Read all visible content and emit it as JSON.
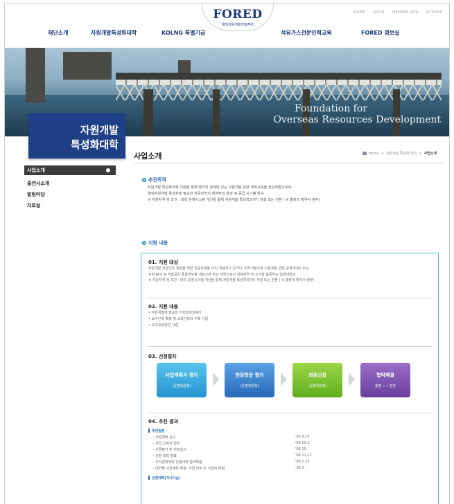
{
  "utility_links": [
    "HOME",
    "LOGIN",
    "MEMBER JOIN",
    "SITEMAP"
  ],
  "logo": {
    "main": "FORED",
    "sub": "해외자원개발진흥재단"
  },
  "nav": [
    "재단소개",
    "자원개발특성화대학",
    "KOLNG 특별기금",
    "석유가스전문인력교육",
    "FORED 정보실"
  ],
  "hero": {
    "line1": "Foundation for",
    "line2": "Overseas Resources Development"
  },
  "section": {
    "line1": "자원개발",
    "line2": "특성화대학"
  },
  "sidebar": {
    "items": [
      {
        "label": "사업소개",
        "active": true
      },
      {
        "label": "출연사소개",
        "active": false
      },
      {
        "label": "알림마당",
        "active": false
      },
      {
        "label": "자료실",
        "active": false
      }
    ]
  },
  "page": {
    "title": "사업소개",
    "breadcrumb": [
      "Home",
      "자원개발 특성화 대학",
      "사업소개"
    ]
  },
  "purpose": {
    "heading": "추진목적",
    "lines": [
      "자원개발 특성화대학 지원을 통해 열악한 상태에 있는 자원개발 관련 대학교육을 정상화함으로써,",
      "해외자원개발 활성화에 필요한 전문인력의 체계적인 양성 및 공급 시스템 확구",
      "※ 지원자격 및 조건 : 대학 운영시스템 개선을 통해 자원개발 특성학과(부) 개설 또는 전환 ( ※ 총장의 확약서 첨부)"
    ]
  },
  "support": {
    "heading": "지원 내용",
    "target": {
      "title": "01. 지원 대상",
      "lines": [
        "자원개발 전문인력 양성을 위한 전공과정을 이미 개설하고 있거나, 학부과정으로 자원개발 관련 공학과(부) 또는",
        "자원 탐사 및 개발공학 통합학부를 개설코자 하는 대학으로서 지원자격 및 조건을 충족하는 일반대학교",
        "※ 지원자격 및 조건 : 대학 운영시스템 개선을 통해 자원개발 특성학과(부) 개설 또는 전환 ( ※ 총장의 확약서 첨부)"
      ]
    },
    "content": {
      "title": "02. 지원 내용",
      "items": [
        "• 자원개발에 필요한 인력양성지원비",
        "• 교수인력 확충 및 교육인프라 구축 사업",
        "• 교수요원양성 사업"
      ]
    },
    "selection": {
      "title": "03. 선정절차",
      "steps": [
        {
          "label": "사업계획서 평가",
          "sub": "(운영위원회)"
        },
        {
          "label": "현장방문 평가",
          "sub": "(운영위원회)"
        },
        {
          "label": "최종선정",
          "sub": "(운영위원회)"
        },
        {
          "label": "협약체결",
          "sub": "총장 ←→ 장관"
        }
      ]
    },
    "results": {
      "title": "04. 추진 결과",
      "schedule_heading": "추진일정",
      "schedule": [
        {
          "item": "– 사업계획 공고",
          "date": "'08.9.19"
        },
        {
          "item": "– 사업 신청서 접수",
          "date": "'08.10.2"
        },
        {
          "item": "– 서류평가 및 현장실사",
          "date": "'08.10."
        },
        {
          "item": "– 선정 대학 발표",
          "date": "'08.11.12"
        },
        {
          "item": "– 지식경제부와 선정대학 협약체결",
          "date": "'09.2.23"
        },
        {
          "item": "– 대학별 사업계획 확정, 사업 착수 및 사업비 배정",
          "date": "'09.3."
        }
      ],
      "selected_heading": "선정대학(가나다순)"
    }
  }
}
